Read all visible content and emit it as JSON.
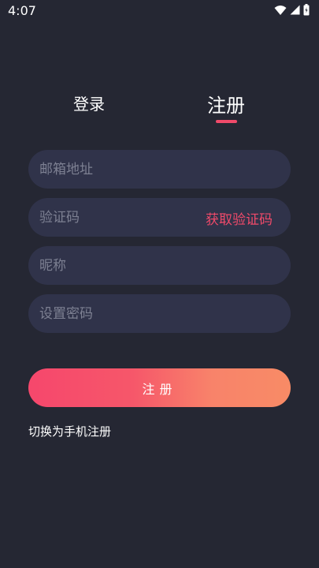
{
  "status_bar": {
    "time": "4:07",
    "icons": [
      "wifi-icon",
      "cell-signal-icon",
      "battery-icon"
    ]
  },
  "tabs": [
    {
      "label": "登录",
      "active": false
    },
    {
      "label": "注册",
      "active": true
    }
  ],
  "form": {
    "email_placeholder": "邮箱地址",
    "code_placeholder": "验证码",
    "get_code_label": "获取验证码",
    "nickname_placeholder": "昵称",
    "password_placeholder": "设置密码",
    "submit_label": "注册",
    "switch_label": "切换为手机注册"
  },
  "colors": {
    "background": "#252733",
    "field_background": "#30334a",
    "accent": "#f04a6a",
    "button_gradient_start": "#f6476c",
    "button_gradient_end": "#f88b66"
  }
}
